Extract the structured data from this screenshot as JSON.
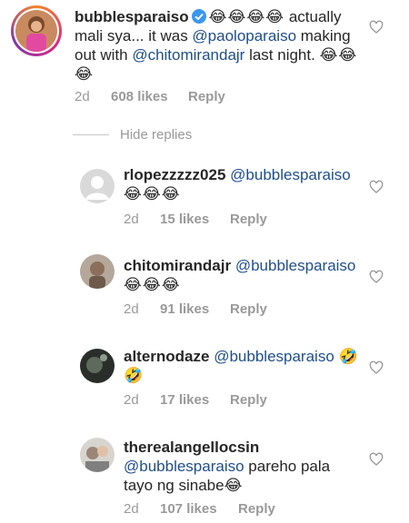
{
  "colors": {
    "mention": "#1f4e8c",
    "meta": "#999999",
    "verified": "#3897f0",
    "ring": "#d6249f"
  },
  "main_comment": {
    "username": "bubblesparaiso",
    "verified_icon": "verified-badge-icon",
    "emoji_prefix": "😂😂😂😂",
    "text_1": " actually mali sya... it was ",
    "mention_1": "@paoloparaiso",
    "text_2": " making out with ",
    "mention_2": "@chitomirandajr",
    "text_3": " last night. ",
    "emoji_suffix": "😂😂😂",
    "time": "2d",
    "likes": "608 likes",
    "reply": "Reply"
  },
  "hide_replies": "Hide replies",
  "replies": [
    {
      "username": "rlopezzzzz025",
      "mention": "@bubblesparaiso",
      "text": "",
      "emoji": "😂😂😂",
      "time": "2d",
      "likes": "15 likes",
      "reply": "Reply"
    },
    {
      "username": "chitomirandajr",
      "mention": "@bubblesparaiso",
      "text": "",
      "emoji": "😂😂😂",
      "time": "2d",
      "likes": "91 likes",
      "reply": "Reply"
    },
    {
      "username": "alternodaze",
      "mention": "@bubblesparaiso",
      "text": "",
      "emoji": "🤣 🤣",
      "time": "2d",
      "likes": "17 likes",
      "reply": "Reply"
    },
    {
      "username": "therealangellocsin",
      "mention": "@bubblesparaiso",
      "text": " pareho pala tayo ng sinabe",
      "emoji": "😂",
      "time": "2d",
      "likes": "107 likes",
      "reply": "Reply"
    }
  ]
}
